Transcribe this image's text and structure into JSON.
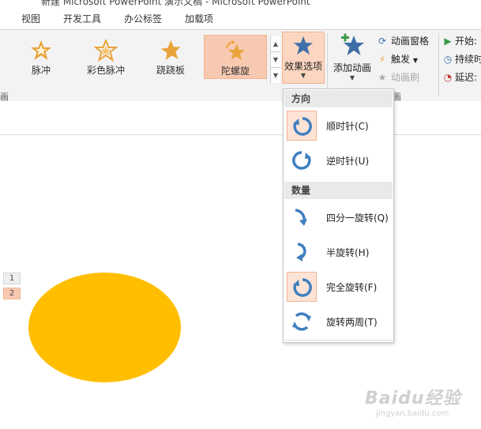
{
  "window": {
    "title": "新建 Microsoft PowerPoint 演示文稿 - Microsoft PowerPoint"
  },
  "menu_tabs": [
    "视图",
    "开发工具",
    "办公标签",
    "加载项"
  ],
  "animation_gallery": {
    "items": [
      {
        "label": "脉冲",
        "icon": "pulse-star-icon",
        "selected": false
      },
      {
        "label": "彩色脉冲",
        "icon": "color-pulse-star-icon",
        "selected": false
      },
      {
        "label": "跷跷板",
        "icon": "teeter-star-icon",
        "selected": false
      },
      {
        "label": "陀螺旋",
        "icon": "spin-star-icon",
        "selected": true
      }
    ]
  },
  "effect_options": {
    "label": "效果选项",
    "icon": "star-icon"
  },
  "add_animation": {
    "label": "添加动画"
  },
  "small_commands": [
    {
      "label": "动画窗格",
      "icon": "animation-pane-icon",
      "disabled": false
    },
    {
      "label": "触发",
      "icon": "lightning-icon",
      "disabled": false,
      "has_dropdown": true
    },
    {
      "label": "动画刷",
      "icon": "animation-painter-icon",
      "disabled": true
    }
  ],
  "timing": [
    {
      "label": "开始:",
      "icon": "play-icon"
    },
    {
      "label": "持续时",
      "icon": "clock-icon"
    },
    {
      "label": "延迟:",
      "icon": "delay-icon"
    }
  ],
  "ribbon_group_label": "画",
  "ribbon_group_label_2": "画",
  "dropdown": {
    "direction_header": "方向",
    "quantity_header": "数量",
    "direction_items": [
      {
        "label": "顺时针(C)",
        "selected": true
      },
      {
        "label": "逆时针(U)",
        "selected": false
      }
    ],
    "quantity_items": [
      {
        "label": "四分一旋转(Q)",
        "selected": false
      },
      {
        "label": "半旋转(H)",
        "selected": false
      },
      {
        "label": "完全旋转(F)",
        "selected": true
      },
      {
        "label": "旋转两周(T)",
        "selected": false
      }
    ]
  },
  "slide": {
    "animation_tags": [
      "1",
      "2"
    ],
    "shape_color": "#ffbf00"
  },
  "watermark": {
    "brand": "Baidu经验",
    "url": "jingyan.baidu.com"
  },
  "colors": {
    "selected_bg": "#f8c9b1",
    "accent_blue": "#3f7fbf",
    "star_gold": "#e8a33a"
  }
}
